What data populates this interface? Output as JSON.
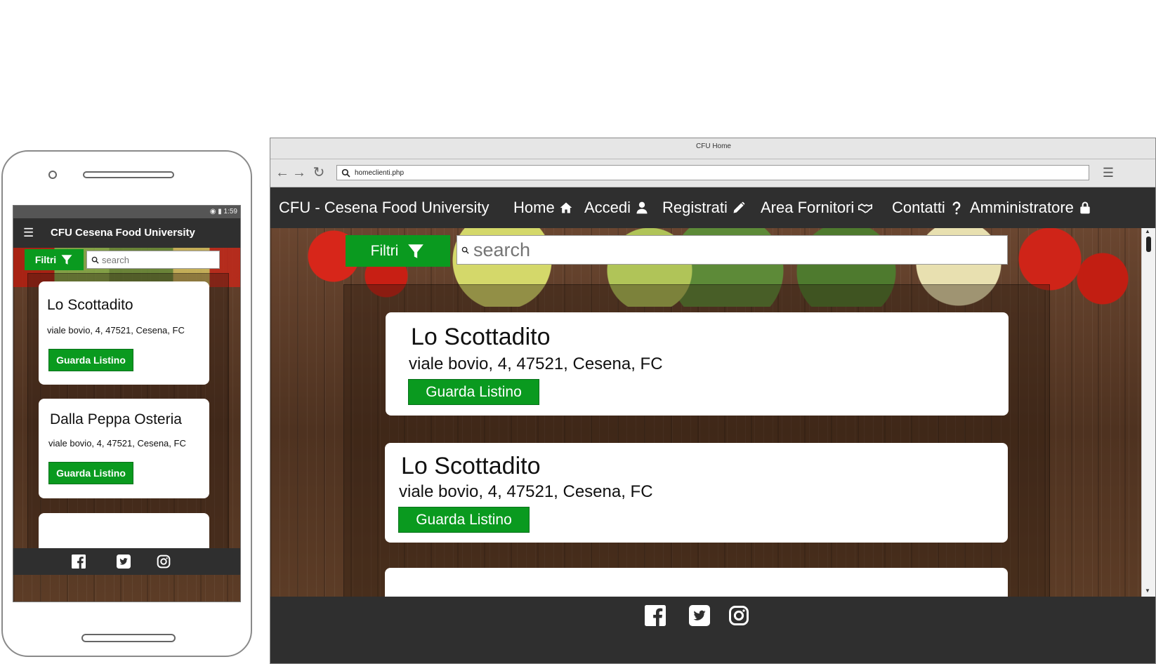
{
  "mobile": {
    "status_time": "1:59",
    "app_title": "CFU Cesena Food University",
    "filter_label": "Filtri",
    "search_placeholder": "search",
    "cards": [
      {
        "name": "Lo Scottadito",
        "address": "viale bovio, 4, 47521, Cesena, FC",
        "button": "Guarda Listino"
      },
      {
        "name": "Dalla Peppa Osteria",
        "address": "viale bovio, 4, 47521, Cesena, FC",
        "button": "Guarda Listino"
      }
    ],
    "footer_icons": [
      "facebook-icon",
      "twitter-icon",
      "instagram-icon"
    ]
  },
  "browser": {
    "window_title": "CFU Home",
    "url": "homeclienti.php",
    "nav": {
      "brand": "CFU - Cesena Food University",
      "items": [
        {
          "label": "Home",
          "icon": "home-icon"
        },
        {
          "label": "Accedi",
          "icon": "user-icon"
        },
        {
          "label": "Registrati",
          "icon": "pencil-icon"
        },
        {
          "label": "Area Fornitori",
          "icon": "handshake-icon"
        },
        {
          "label": "Contatti",
          "icon": "question-icon"
        },
        {
          "label": "Amministratore",
          "icon": "lock-icon"
        }
      ]
    },
    "filter_label": "Filtri",
    "search_placeholder": "search",
    "cards": [
      {
        "name": "Lo Scottadito",
        "address": "viale bovio, 4, 47521, Cesena, FC",
        "button": "Guarda Listino"
      },
      {
        "name": "Lo Scottadito",
        "address": "viale bovio, 4, 47521, Cesena, FC",
        "button": "Guarda Listino"
      }
    ],
    "footer_icons": [
      "facebook-icon",
      "twitter-icon",
      "instagram-icon"
    ]
  },
  "colors": {
    "accent_green": "#0a9a1f",
    "dark_bar": "#2f2f2f"
  }
}
